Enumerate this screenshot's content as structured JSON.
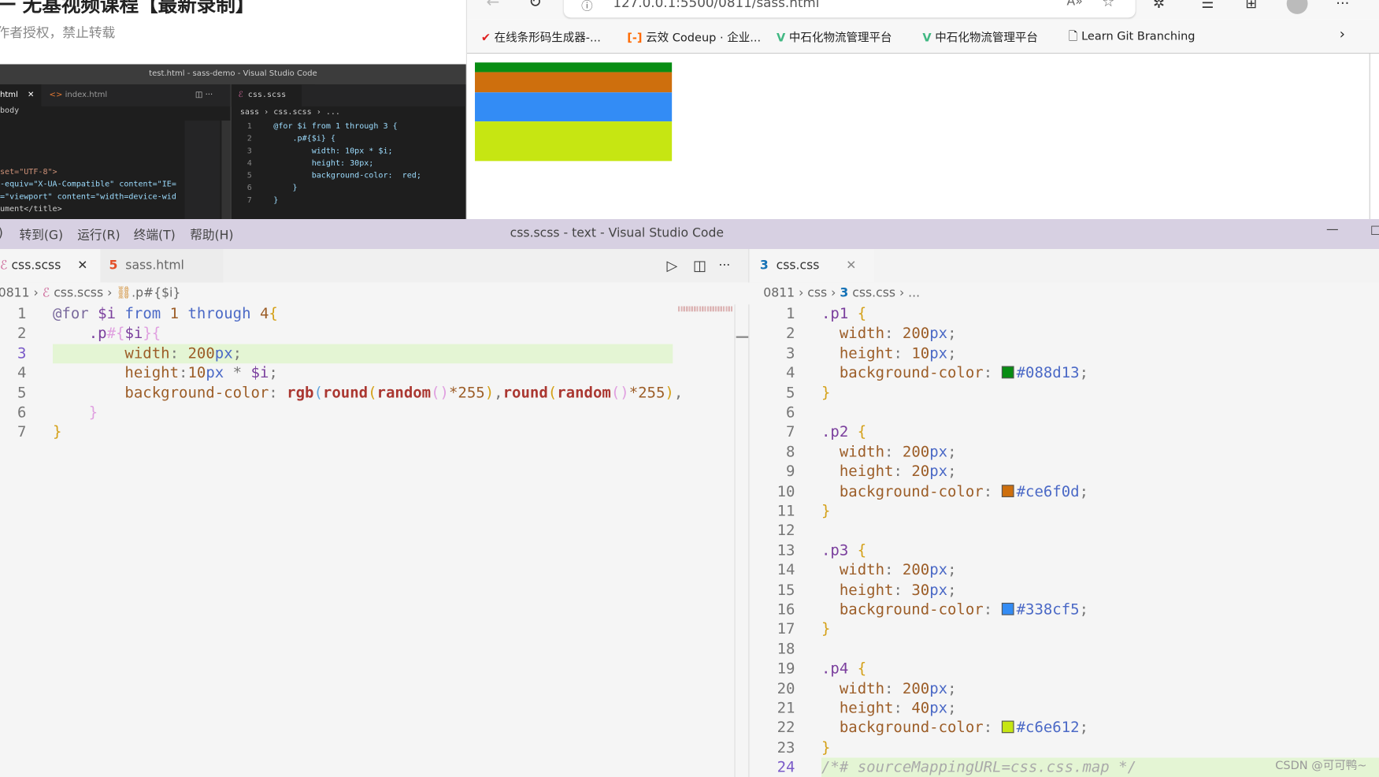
{
  "article": {
    "title": "一 无基视频课程【最新录制】",
    "subtitle": "作者授权，禁止转载"
  },
  "dark_vscode": {
    "title": "test.html - sass-demo - Visual Studio Code",
    "tabs": [
      {
        "label": "html"
      },
      {
        "label": "index.html"
      },
      {
        "label": "css.scss"
      }
    ],
    "left_breadcrumb": "body",
    "left_lines": [
      "set=\"UTF-8\">",
      "-equiv=\"X-UA-Compatible\" content=\"IE=",
      "=\"viewport\" content=\"width=device-wid",
      "ument</title>"
    ],
    "right_breadcrumb": [
      "sass",
      "css.scss",
      "..."
    ],
    "right_lines": [
      "@for $i from 1 through 3 {",
      "    .p#{$i} {",
      "        width: 10px * $i;",
      "        height: 30px;",
      "        background-color:  red;",
      "    }",
      "}"
    ]
  },
  "browser": {
    "url": "127.0.0.1:5500/0811/sass.html",
    "bookmarks": [
      {
        "label": "在线条形码生成器-...",
        "icon": "check-icon"
      },
      {
        "label": "云效 Codeup · 企业...",
        "icon": "codeup-icon"
      },
      {
        "label": "中石化物流管理平台",
        "icon": "vue-icon"
      },
      {
        "label": "中石化物流管理平台",
        "icon": "vue-icon"
      },
      {
        "label": "Learn Git Branching",
        "icon": "page-icon"
      }
    ],
    "boxes": [
      {
        "color": "#088d13"
      },
      {
        "color": "#ce6f0d"
      },
      {
        "color": "#338cf5"
      },
      {
        "color": "#c6e612"
      }
    ]
  },
  "vscode": {
    "title": "css.scss - text - Visual Studio Code",
    "menu": [
      ")",
      "转到(G)",
      "运行(R)",
      "终端(T)",
      "帮助(H)"
    ],
    "left_tabs": [
      {
        "label": "css.scss",
        "active": true
      },
      {
        "label": "sass.html"
      }
    ],
    "left_breadcrumb": [
      "0811",
      "css.scss",
      ".p#{$i}"
    ],
    "right_tabs": [
      {
        "label": "css.css",
        "active": true
      }
    ],
    "right_breadcrumb": [
      "0811",
      "css",
      "css.css",
      "..."
    ],
    "left_code": [
      [
        [
          "@for ",
          "at"
        ],
        [
          "$i ",
          "v"
        ],
        [
          "from ",
          "k"
        ],
        [
          "1 ",
          "n"
        ],
        [
          "through ",
          "k"
        ],
        [
          "4",
          "n"
        ],
        [
          "{",
          "b"
        ]
      ],
      [
        [
          "    .p",
          "s"
        ],
        [
          "#{",
          "i"
        ],
        [
          "$i",
          "v"
        ],
        [
          "}",
          "i"
        ],
        [
          "{",
          "i"
        ]
      ],
      [
        [
          "        width",
          "p"
        ],
        [
          ": ",
          "o"
        ],
        [
          "200",
          "n"
        ],
        [
          "px",
          "u"
        ],
        [
          ";",
          "o"
        ]
      ],
      [
        [
          "        height",
          "p"
        ],
        [
          ":",
          "o"
        ],
        [
          "10",
          "n"
        ],
        [
          "px",
          "u"
        ],
        [
          " * ",
          "o"
        ],
        [
          "$i",
          "v"
        ],
        [
          ";",
          "o"
        ]
      ],
      [
        [
          "        background-color",
          "p"
        ],
        [
          ": ",
          "o"
        ],
        [
          "rgb",
          "f"
        ],
        [
          "(",
          "bl"
        ],
        [
          "round",
          "f"
        ],
        [
          "(",
          "b"
        ],
        [
          "random",
          "f"
        ],
        [
          "()",
          "i"
        ],
        [
          "*255",
          "n"
        ],
        [
          ")",
          "b"
        ],
        [
          ",",
          "o"
        ],
        [
          "round",
          "f"
        ],
        [
          "(",
          "b"
        ],
        [
          "random",
          "f"
        ],
        [
          "()",
          "i"
        ],
        [
          "*255",
          "n"
        ],
        [
          ")",
          "b"
        ],
        [
          ",",
          "o"
        ]
      ],
      [
        [
          "    ",
          "o"
        ],
        [
          "}",
          "i"
        ]
      ],
      [
        [
          "}",
          "b"
        ]
      ]
    ],
    "right_code": [
      [
        [
          ".p1 ",
          "s"
        ],
        [
          "{",
          "b"
        ]
      ],
      [
        [
          "  width",
          "p"
        ],
        [
          ": ",
          "o"
        ],
        [
          "200",
          "n"
        ],
        [
          "px",
          "u"
        ],
        [
          ";",
          "o"
        ]
      ],
      [
        [
          "  height",
          "p"
        ],
        [
          ": ",
          "o"
        ],
        [
          "10",
          "n"
        ],
        [
          "px",
          "u"
        ],
        [
          ";",
          "o"
        ]
      ],
      [
        [
          "  background-color",
          "p"
        ],
        [
          ": ",
          "o"
        ],
        [
          "#088d13",
          "sw"
        ],
        [
          "#088d13",
          "u"
        ],
        [
          ";",
          "o"
        ]
      ],
      [
        [
          "}",
          "b"
        ]
      ],
      [],
      [
        [
          ".p2 ",
          "s"
        ],
        [
          "{",
          "b"
        ]
      ],
      [
        [
          "  width",
          "p"
        ],
        [
          ": ",
          "o"
        ],
        [
          "200",
          "n"
        ],
        [
          "px",
          "u"
        ],
        [
          ";",
          "o"
        ]
      ],
      [
        [
          "  height",
          "p"
        ],
        [
          ": ",
          "o"
        ],
        [
          "20",
          "n"
        ],
        [
          "px",
          "u"
        ],
        [
          ";",
          "o"
        ]
      ],
      [
        [
          "  background-color",
          "p"
        ],
        [
          ": ",
          "o"
        ],
        [
          "#ce6f0d",
          "sw"
        ],
        [
          "#ce6f0d",
          "u"
        ],
        [
          ";",
          "o"
        ]
      ],
      [
        [
          "}",
          "b"
        ]
      ],
      [],
      [
        [
          ".p3 ",
          "s"
        ],
        [
          "{",
          "b"
        ]
      ],
      [
        [
          "  width",
          "p"
        ],
        [
          ": ",
          "o"
        ],
        [
          "200",
          "n"
        ],
        [
          "px",
          "u"
        ],
        [
          ";",
          "o"
        ]
      ],
      [
        [
          "  height",
          "p"
        ],
        [
          ": ",
          "o"
        ],
        [
          "30",
          "n"
        ],
        [
          "px",
          "u"
        ],
        [
          ";",
          "o"
        ]
      ],
      [
        [
          "  background-color",
          "p"
        ],
        [
          ": ",
          "o"
        ],
        [
          "#338cf5",
          "sw"
        ],
        [
          "#338cf5",
          "u"
        ],
        [
          ";",
          "o"
        ]
      ],
      [
        [
          "}",
          "b"
        ]
      ],
      [],
      [
        [
          ".p4 ",
          "s"
        ],
        [
          "{",
          "b"
        ]
      ],
      [
        [
          "  width",
          "p"
        ],
        [
          ": ",
          "o"
        ],
        [
          "200",
          "n"
        ],
        [
          "px",
          "u"
        ],
        [
          ";",
          "o"
        ]
      ],
      [
        [
          "  height",
          "p"
        ],
        [
          ": ",
          "o"
        ],
        [
          "40",
          "n"
        ],
        [
          "px",
          "u"
        ],
        [
          ";",
          "o"
        ]
      ],
      [
        [
          "  background-color",
          "p"
        ],
        [
          ": ",
          "o"
        ],
        [
          "#c6e612",
          "sw"
        ],
        [
          "#c6e612",
          "u"
        ],
        [
          ";",
          "o"
        ]
      ],
      [
        [
          "}",
          "b"
        ]
      ],
      [
        [
          "/*# sourceMappingURL=css.css.map */",
          "c"
        ]
      ]
    ],
    "left_active_line": 3,
    "right_active_line": 24
  },
  "watermark": "CSDN @可可鸭~"
}
